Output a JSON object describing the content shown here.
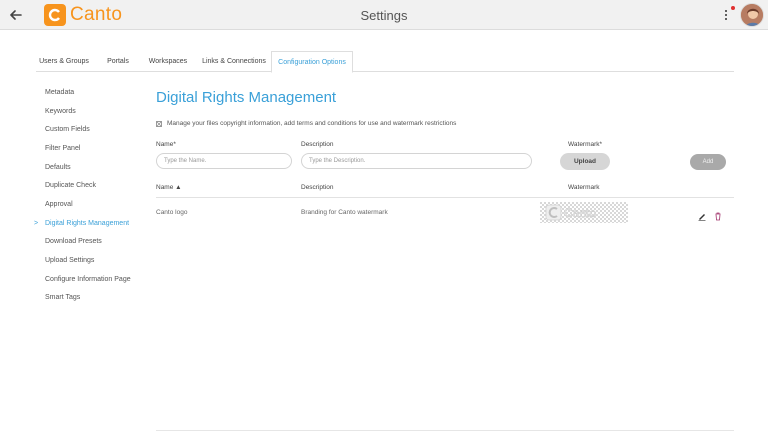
{
  "header": {
    "logo_text": "Canto",
    "title": "Settings",
    "back_icon": "arrow-left-icon",
    "menu_icon": "kebab-menu-icon",
    "accent_color": "#f7941d"
  },
  "tabs": [
    {
      "label": "Users & Groups"
    },
    {
      "label": "Portals"
    },
    {
      "label": "Workspaces"
    },
    {
      "label": "Links & Connections"
    },
    {
      "label": "Configuration Options",
      "active": true
    }
  ],
  "sidebar": {
    "items": [
      {
        "label": "Metadata"
      },
      {
        "label": "Keywords"
      },
      {
        "label": "Custom Fields"
      },
      {
        "label": "Filter Panel"
      },
      {
        "label": "Defaults"
      },
      {
        "label": "Duplicate Check"
      },
      {
        "label": "Approval"
      },
      {
        "label": "Digital Rights Management",
        "active": true
      },
      {
        "label": "Download Presets"
      },
      {
        "label": "Upload Settings"
      },
      {
        "label": "Configure Information Page"
      },
      {
        "label": "Smart Tags"
      }
    ],
    "active_marker": ">"
  },
  "main": {
    "heading": "Digital Rights Management",
    "checkbox_label": "Manage your files copyright information, add terms and conditions for use and watermark restrictions",
    "form": {
      "name_label": "Name*",
      "name_placeholder": "Type the Name.",
      "description_label": "Description",
      "description_placeholder": "Type the Description.",
      "watermark_label": "Watermark*",
      "upload_label": "Upload",
      "add_label": "Add"
    },
    "table": {
      "headers": {
        "name": "Name ▲",
        "description": "Description",
        "watermark": "Watermark"
      },
      "rows": [
        {
          "name": "Canto logo",
          "description": "Branding for Canto watermark",
          "watermark": "canto-logo-watermark"
        }
      ]
    }
  },
  "colors": {
    "link_blue": "#3aa0d8",
    "topbar_bg": "#f1f1f1"
  }
}
